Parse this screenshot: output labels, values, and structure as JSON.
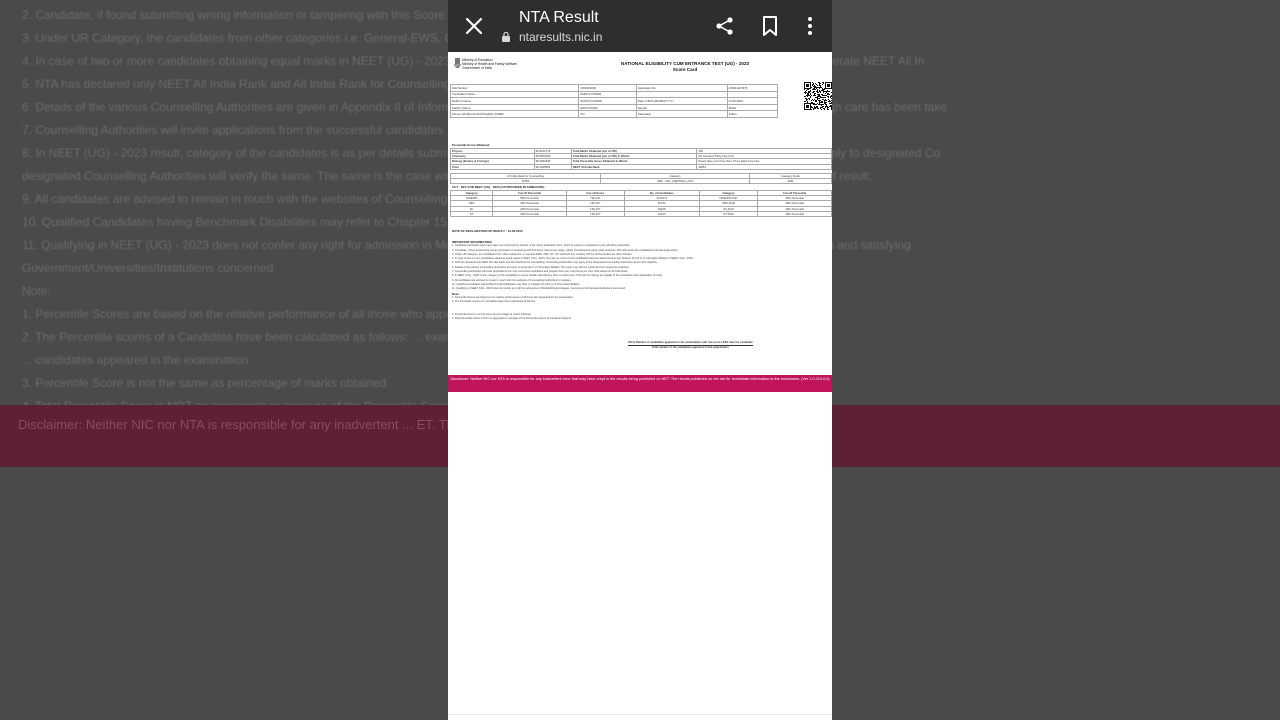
{
  "browser": {
    "title": "NTA Result",
    "url": "ntaresults.nic.in"
  },
  "background": {
    "lines": [
      "2. Candidate, if found submitting wrong information or tampering with this Score ... cancel the candidature and take legal action as per applicable laws.",
      "3. Under UR Category, the candidates from other categories i.e. General-EWS, OBC ...",
      "4. In case of two or more candidates obtaining equal marks in NEET (UG) - 2023 ... Chapter 15 (15.2) of Information Bulletin of NEET (UG) - 2023 to generate NEET All In",
      "5. NTA has declared only NEET All India Rank and All India Rank for Counselling ... eligibility. NTA has no role to play in this.",
      "6. Details of the various Counselling Authorities are given in Appendix II of Information ... NTA is not responsible for change of any of the addresses though care has been take",
      "7. Counselling Authorities will invite applications from the successful candidates ...",
      "8. In NEET (UG) - 2023 result, category of the candidates is as per details submitted ... any other category in the State Category List, candidates may apply to designated Co",
      "designated Counselling Authorities will verify the same. The same is the case with ... NTA will not change any details of the candidates after declaration of result.",
      "9. All candidates are advised to remain in touch with the websites of Counselling ...",
      "10. Qualified Candidates having Benchmark Disabilities may refer to Chapter 15 ...",
      "11. Qualifying in NEET (UG) - 2023 does not confer any right for admission in Med ... for admission to Medical/Dental Colleges is subject to merit position and satisfying",
      "Government/Universities/Institutions concerned.",
      "Note:",
      "1. Percentile Scores are based on the relative performance of all those who appear ...",
      "2. The Percentile scores of a Candidate have been calculated as follows: ... examination with raw score LESS than the candidate",
      "... candidates appeared in the examination",
      "3. Percentile Score is not the same as percentage of marks obtained.",
      "4. Total Percentile Score is NOT an aggregate or average of the Percentile Scores ..."
    ],
    "band_text": "Disclaimer: Neither NIC nor NTA is responsible for any inadvertent ... ET. The results published on net are for Immediate information to the"
  },
  "scorecard": {
    "ministry": [
      "Ministry of Education",
      "Ministry of Health and Family Welfare",
      "Government of India"
    ],
    "title_line1": "NATIONAL ELIGIBILITY CUM ENTRANCE TEST (UG) - 2023",
    "title_line2": "Score Card",
    "details": [
      [
        "Roll Number",
        "3302000009",
        "Application No.",
        "230411407973"
      ],
      [
        "Candidate's Name",
        "DHRUV KUMAR",
        "",
        ""
      ],
      [
        "Mother's Name",
        "SUNITA KUMARI",
        "Date of Birth (DD/MM/YYYY)",
        "01.06.2005"
      ],
      [
        "Father's Name",
        "RAM KUMAR",
        "Gender",
        "MALE"
      ],
      [
        "Person with Benchmark Disability (PwBD)",
        "NO",
        "Nationality",
        "Indian"
      ]
    ],
    "score_heading": "Percentile Score Obtained",
    "scores": [
      [
        "Physics",
        "99.9142776",
        "Total Marks Obtained (out of 720)",
        "430"
      ],
      [
        "Chemistry",
        "99.9655295",
        "Total Marks Obtained (out of 720) in Words",
        "Six Hundred Thirty Five Only"
      ],
      [
        "Biology (Botany & Zoology)",
        "98.2991830",
        "Total Percentile Score Obtained in Words",
        "Ninety Nine point Five Zero Three Eight Five Five"
      ],
      [
        "Total",
        "99.4038564",
        "NEET All India Rank",
        "11854"
      ]
    ],
    "rank_headers": [
      "All India Rank for Counselling",
      "Category",
      "Category Rank"
    ],
    "rank_values": [
      "11854",
      "OBC - NCL (CENTRAL LIST)",
      "4931"
    ],
    "cutoff_heading": "CUT - OFF FOR NEET (UG) - 2023 (AS PROVIDED IN ANNEXURE)",
    "cutoff_headers": [
      "Category",
      "Cut-off Percentile",
      "Cut-off Score",
      "No. of Candidates",
      "Category",
      "Cut-off Percentile"
    ],
    "cutoff_rows": [
      [
        "UR/EWS",
        "50th Percentile",
        "720-137",
        "1014372",
        "UR/EWS-PwD",
        "45th Percentile"
      ],
      [
        "OBC",
        "40th Percentile",
        "136-107",
        "93742",
        "OBC-PwD",
        "40th Percentile"
      ],
      [
        "SC",
        "40th Percentile",
        "136-107",
        "29918",
        "SC-PwD",
        "40th Percentile"
      ],
      [
        "ST",
        "40th Percentile",
        "136-107",
        "12423",
        "ST-PwD",
        "40th Percentile"
      ]
    ],
    "declaration": "DATE OF DECLARATION OF RESULT : 13.06.2023",
    "important_heading": "IMPORTANT INFORMATION:",
    "important_lines": [
      "1. Candidate particulars have been taken as mentioned by him/her in the online application form, which is subject to verification by the admitting authorities.",
      "2. Candidate, if found submitting wrong information or tampering with this Score Card at any stage, will be considered as using unfair practices. NTA will cancel the candidature and take legal action.",
      "3. Under UR Category, the candidates from other categories i.e. General-EWS, OBC, SC, ST and PwD (not meeting UR Cut off Percentile) are also included.",
      "4. In case of two or more candidates obtaining equal marks in NEET (UG) - 2023, the inter-se merit of such candidates has been determined as per Chapter 15 (15.2) of Information Bulletin of NEET (UG) - 2023.",
      "5. NTA has declared only NEET All India Rank and All India Rank for Counselling. Counselling Authorities may apply to the designated Counselling Authorities as per their eligibility.",
      "6. Details of the various Counselling Authorities are given in Appendix II of Information Bulletin. The same may also be confirmed from respective websites.",
      "7. Counselling Authorities will invite applications from the successful candidates and prepare their own merit list as per their rules based on All India Rank.",
      "8. In NEET (UG) - 2023 result, category of the candidates is as per details submitted by them in online form. NTA will not change any details of the candidates after declaration of result.",
      "9. All candidates are advised to remain in touch with the websites of Counselling Authorities for updates.",
      "10. Qualified Candidates having Benchmark Disabilities may refer to Chapter 15 (15.1.c) of Information Bulletin.",
      "11. Qualifying in NEET (UG) - 2023 does not confer any right for admission in Medical/Dental Colleges. Government/Universities/Institutions concerned."
    ],
    "note_heading": "Note:",
    "note_lines": [
      "1. Percentile Scores are based on the relative performance of all those who appeared for the examination.",
      "2. The Percentile scores of a Candidate have been calculated as follows:",
      "",
      "",
      "3. Percentile Score is not the same as percentage of marks obtained.",
      "4. Total Percentile Score is NOT an aggregate or average of the Percentile Scores of individual subjects."
    ],
    "formula_top": "100 X Number of candidates appeared in the examination with raw score LESS than the candidate",
    "formula_bottom": "Total number of the candidates appeared in the examination"
  },
  "disclaimer": "Disclaimer: Neither NIC nor NTA is responsible for any inadvertent error that may have crept in the results being published on NET. The results published on net are for Immediate information to the examinees. (Ver 1.0.210.0.0)"
}
